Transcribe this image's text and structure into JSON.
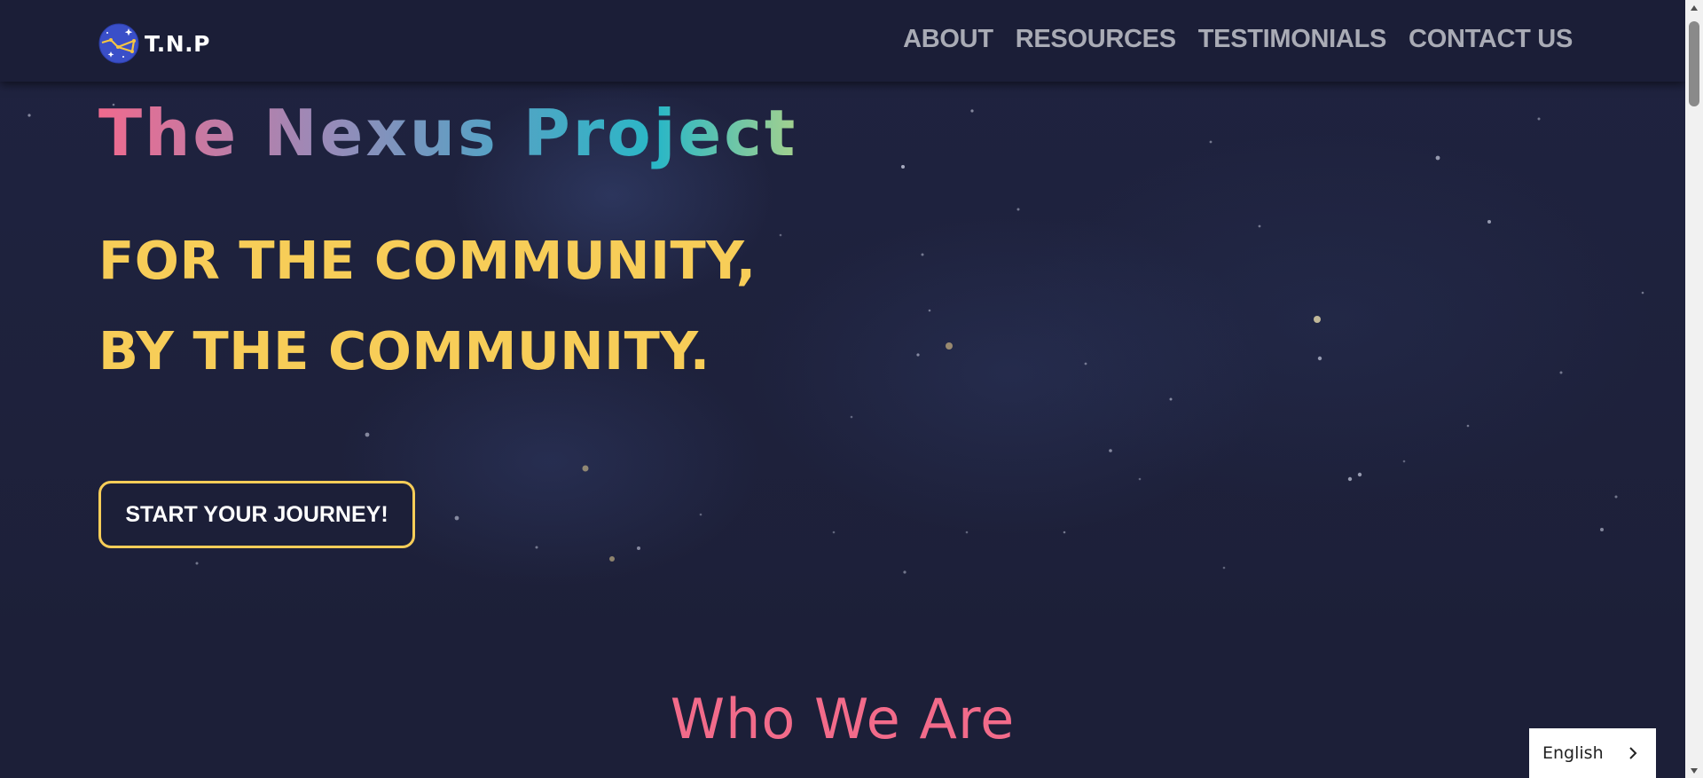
{
  "header": {
    "brand": "T.N.P",
    "nav": [
      {
        "label": "ABOUT"
      },
      {
        "label": "RESOURCES"
      },
      {
        "label": "TESTIMONIALS"
      },
      {
        "label": "CONTACT US"
      }
    ]
  },
  "hero": {
    "title": "The Nexus Project",
    "tagline_line1": "FOR THE COMMUNITY,",
    "tagline_line2": "BY THE COMMUNITY.",
    "cta_label": "START YOUR JOURNEY!"
  },
  "about": {
    "heading": "Who We Are"
  },
  "language_selector": {
    "selected": "English"
  },
  "colors": {
    "background": "#1c1f38",
    "header": "#1b1e37",
    "accent_yellow": "#f7cd58",
    "accent_pink": "#f26b8a",
    "nav_text": "#a9abb5"
  }
}
